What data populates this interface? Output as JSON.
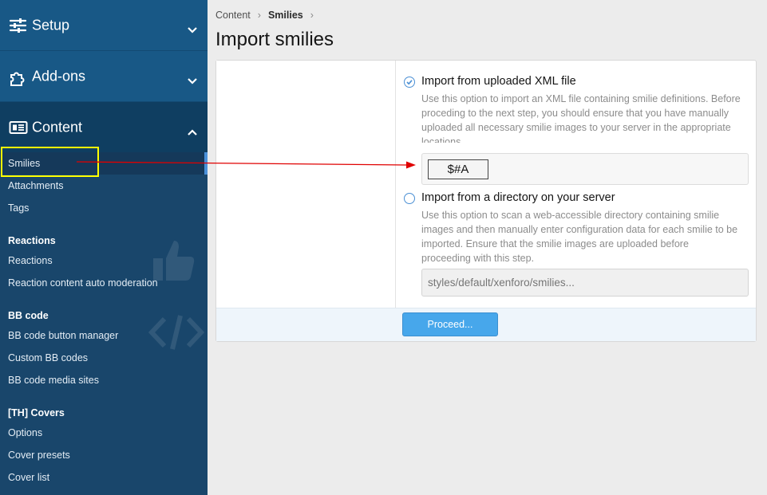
{
  "sidebar": {
    "sections": [
      {
        "label": "Setup",
        "icon": "sliders-icon",
        "chevron": "chevron-down-icon"
      },
      {
        "label": "Add-ons",
        "icon": "puzzle-icon",
        "chevron": "chevron-down-icon"
      },
      {
        "label": "Content",
        "icon": "newspaper-icon",
        "chevron": "chevron-up-icon"
      }
    ],
    "content_items": {
      "smilies": "Smilies",
      "attachments": "Attachments",
      "tags": "Tags",
      "reactions_head": "Reactions",
      "reactions": "Reactions",
      "reaction_moderation": "Reaction content auto moderation",
      "bbcode_head": "BB code",
      "bbcode_button_manager": "BB code button manager",
      "custom_bbcodes": "Custom BB codes",
      "bbcode_media_sites": "BB code media sites",
      "covers_head": "[TH] Covers",
      "options": "Options",
      "cover_presets": "Cover presets",
      "cover_list": "Cover list"
    },
    "colors": {
      "background": "#19466b",
      "section": "#185886",
      "accent": "#4a90d9"
    }
  },
  "breadcrumb": {
    "items": [
      "Content",
      "Smilies"
    ]
  },
  "page": {
    "title": "Import smilies"
  },
  "form": {
    "option_xml": {
      "label": "Import from uploaded XML file",
      "description": "Use this option to import an XML file containing smilie definitions. Before proceding to the next step, you should ensure that you have manually uploaded all necessary smilie images to your server in the appropriate locations.",
      "selected": true
    },
    "file_button_label": "$#A",
    "option_dir": {
      "label": "Import from a directory on your server",
      "description": "Use this option to scan a web-accessible directory containing smilie images and then manually enter configuration data for each smilie to be imported. Ensure that the smilie images are uploaded before proceeding with this step.",
      "selected": false
    },
    "dir_placeholder": "styles/default/xenforo/smilies...",
    "proceed_label": "Proceed..."
  },
  "annotation": {
    "highlight_color": "#ffff00",
    "arrow_color": "#e00000"
  }
}
